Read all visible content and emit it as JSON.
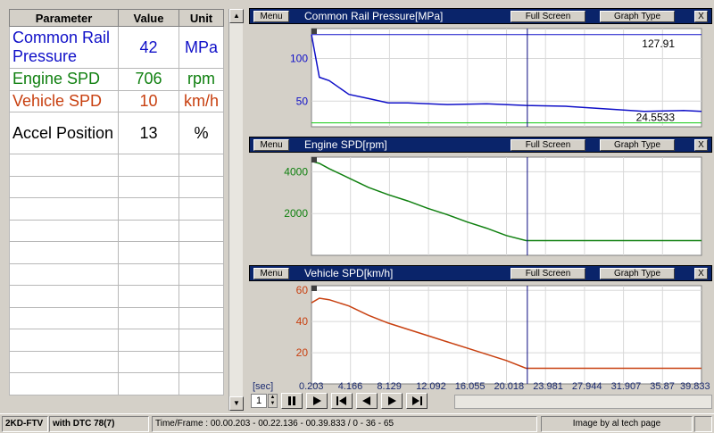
{
  "table": {
    "headers": [
      "Parameter",
      "Value",
      "Unit"
    ],
    "rows": [
      {
        "name": "Common Rail Pressure",
        "value": "42",
        "unit": "MPa",
        "color": "#1010c8"
      },
      {
        "name": "Engine SPD",
        "value": "706",
        "unit": "rpm",
        "color": "#108010"
      },
      {
        "name": "Vehicle SPD",
        "value": "10",
        "unit": "km/h",
        "color": "#c84010"
      },
      {
        "name": "Accel Position",
        "value": "13",
        "unit": "%",
        "color": "#000000"
      }
    ],
    "empty_rows": 11
  },
  "graphs": [
    {
      "menu_label": "Menu",
      "title": "Common Rail Pressure[MPa]",
      "fullscreen_label": "Full Screen",
      "graphtype_label": "Graph Type",
      "close_label": "X",
      "color": "#1010c8",
      "y_ticks": [
        "100",
        "50"
      ],
      "max_label": "127.91",
      "min_label": "24.5533"
    },
    {
      "menu_label": "Menu",
      "title": "Engine SPD[rpm]",
      "fullscreen_label": "Full Screen",
      "graphtype_label": "Graph Type",
      "close_label": "X",
      "color": "#108010",
      "y_ticks": [
        "4000",
        "2000"
      ]
    },
    {
      "menu_label": "Menu",
      "title": "Vehicle SPD[km/h]",
      "fullscreen_label": "Full Screen",
      "graphtype_label": "Graph Type",
      "close_label": "X",
      "color": "#c84010",
      "y_ticks": [
        "60",
        "40",
        "20"
      ]
    }
  ],
  "xaxis": {
    "unit_label": "[sec]",
    "ticks": [
      "0.203",
      "4.166",
      "8.129",
      "12.092",
      "16.055",
      "20.018",
      "23.981",
      "27.944",
      "31.907",
      "35.87",
      "39.833"
    ]
  },
  "controls": {
    "speed_value": "1",
    "pause_icon": "pause-icon",
    "play_icon": "play-icon",
    "step_back_icon": "step-back-icon",
    "back_icon": "back-icon",
    "forward_icon": "forward-icon",
    "step_forward_icon": "step-forward-icon"
  },
  "status": {
    "vehicle": "2KD-FTV",
    "dtc": "with DTC 78(7)",
    "time_frame": "Time/Frame : 00.00.203 - 00.22.136 - 00.39.833 / 0 - 36 - 65",
    "credit": "Image by al tech page"
  },
  "chart_data": [
    {
      "type": "line",
      "title": "Common Rail Pressure[MPa]",
      "x": [
        0.203,
        1,
        2,
        4,
        6,
        8,
        10,
        14,
        18,
        22,
        26,
        30,
        34,
        38,
        39.833
      ],
      "values": [
        127.91,
        78,
        74,
        58,
        53,
        48,
        48,
        46,
        47,
        45,
        44,
        41,
        38,
        39,
        38
      ],
      "min_line": 24.5533,
      "max_line": 127.91,
      "ylim": [
        20,
        135
      ],
      "xlim": [
        0.203,
        39.833
      ],
      "cursor_x": 22.136,
      "grid": true
    },
    {
      "type": "line",
      "title": "Engine SPD[rpm]",
      "x": [
        0.203,
        1,
        2,
        4,
        6,
        8,
        10,
        12,
        14,
        16,
        18,
        20,
        22,
        26,
        30,
        34,
        39.833
      ],
      "values": [
        4500,
        4400,
        4150,
        3700,
        3250,
        2900,
        2600,
        2250,
        1950,
        1600,
        1300,
        950,
        706,
        706,
        706,
        706,
        706
      ],
      "ylim": [
        0,
        4700
      ],
      "xlim": [
        0.203,
        39.833
      ],
      "cursor_x": 22.136,
      "grid": true
    },
    {
      "type": "line",
      "title": "Vehicle SPD[km/h]",
      "x": [
        0.203,
        1,
        2,
        4,
        6,
        8,
        10,
        12,
        14,
        16,
        18,
        20,
        22,
        26,
        30,
        34,
        39.833
      ],
      "values": [
        52,
        55,
        54,
        50,
        44,
        39,
        35,
        31,
        27,
        23,
        19,
        15,
        10,
        10,
        10,
        10,
        10
      ],
      "ylim": [
        0,
        63
      ],
      "xlim": [
        0.203,
        39.833
      ],
      "cursor_x": 22.136,
      "grid": true
    }
  ]
}
